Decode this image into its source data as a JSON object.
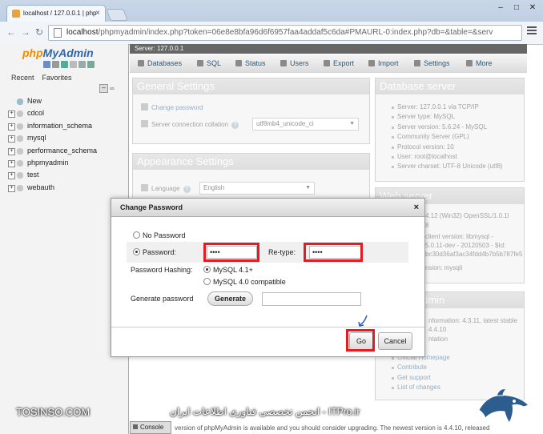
{
  "browser": {
    "tab_title": "localhost / 127.0.0.1 | php",
    "url_host": "localhost",
    "url_rest": "/phpmyadmin/index.php?token=06e8e8bfa96d6f6957faa4addaf5c6da#PMAURL-0:index.php?db=&table=&serv"
  },
  "sidebar": {
    "logo_php": "php",
    "logo_myadmin": "MyAdmin",
    "recent": "Recent",
    "favorites": "Favorites",
    "new_item": "New",
    "databases": [
      "cdcol",
      "information_schema",
      "mysql",
      "performance_schema",
      "phpmyadmin",
      "test",
      "webauth"
    ]
  },
  "server_bar": "Server: 127.0.0.1",
  "menu": [
    "Databases",
    "SQL",
    "Status",
    "Users",
    "Export",
    "Import",
    "Settings",
    "More"
  ],
  "general_settings": {
    "title": "General Settings",
    "change_password": "Change password",
    "collation_label": "Server connection collation",
    "collation_value": "utf8mb4_unicode_ci"
  },
  "appearance_settings": {
    "title": "Appearance Settings",
    "language_label": "Language",
    "language_value": "English"
  },
  "database_server": {
    "title": "Database server",
    "items": [
      "Server: 127.0.0.1 via TCP/IP",
      "Server type: MySQL",
      "Server version: 5.6.24 - MySQL",
      "Community Server (GPL)",
      "Protocol version: 10",
      "User: root@localhost",
      "Server charset: UTF-8 Unicode (utf8)"
    ]
  },
  "web_server": {
    "title": "Web server",
    "lines": [
      "4.12 (Win32) OpenSSL/1.0.1l",
      "8",
      "client version: libmysql -",
      "5.0.11-dev - 20120503 - $Id:",
      "bc30d36af3ac34fdd4b7b5b787fe5",
      "nsion: mysqli"
    ]
  },
  "phpmyadmin_panel": {
    "title": "dmin",
    "lines": [
      "nformation: 4.3.11, latest stable",
      "4.4.10",
      "ntation"
    ],
    "links": [
      "Official Homepage",
      "Contribute",
      "Get support",
      "List of changes"
    ]
  },
  "console_label": "Console",
  "bottom_note": "version of phpMyAdmin is available and you should consider upgrading. The newest version is 4.4.10, released",
  "dialog": {
    "title": "Change Password",
    "no_password": "No Password",
    "password_label": "Password:",
    "password_value": "••••",
    "retype_label": "Re-type:",
    "retype_value": "••••",
    "hashing_label": "Password Hashing:",
    "hash_option_1": "MySQL 4.1+",
    "hash_option_2": "MySQL 4.0 compatible",
    "generate_label": "Generate password",
    "generate_button": "Generate",
    "go_button": "Go",
    "cancel_button": "Cancel"
  },
  "watermarks": {
    "left": "TOSINSO.COM",
    "center": "انجمن تخصصی فناوری اطلاعات ایران - ITPro.ir"
  },
  "colors": {
    "highlight": "#e31b23",
    "link": "#235a81",
    "accent": "#f28c00"
  }
}
